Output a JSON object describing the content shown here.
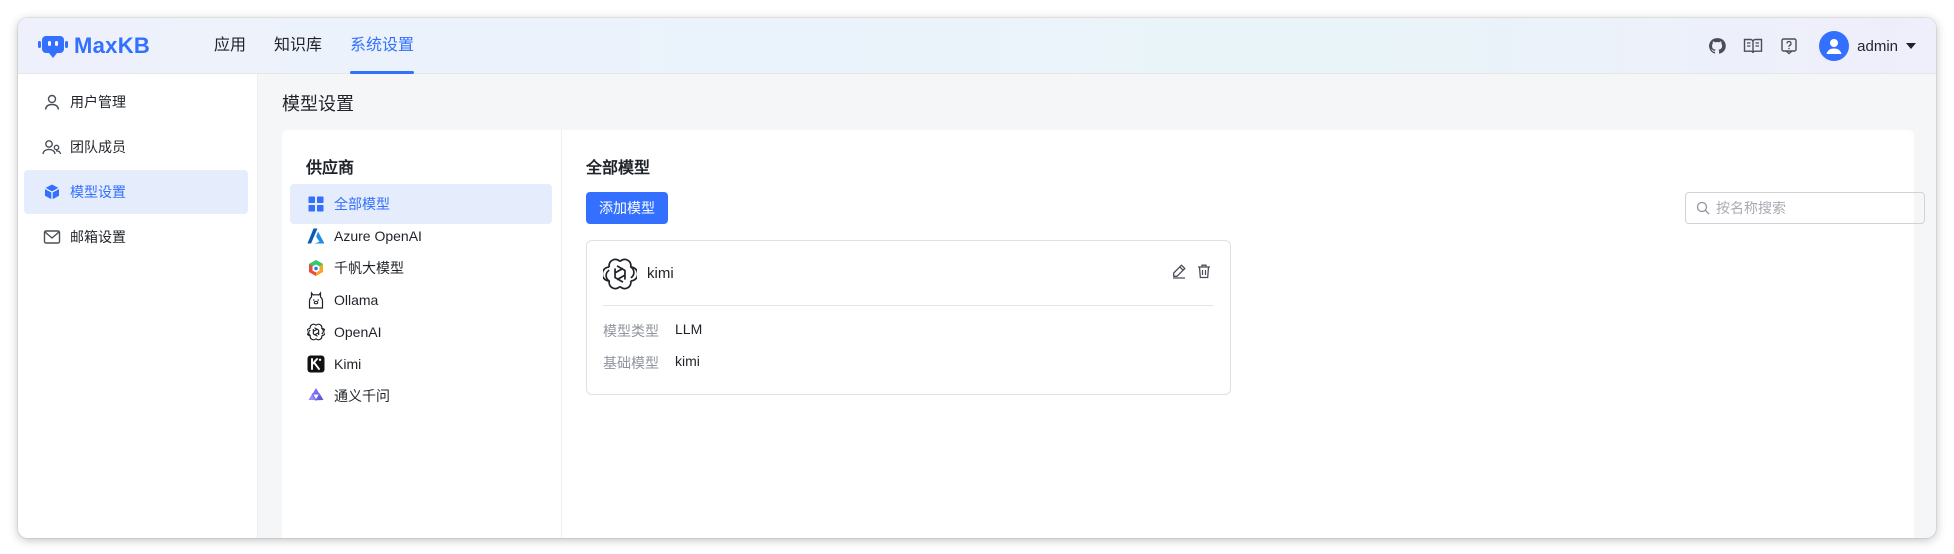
{
  "app": {
    "name": "MaxKB"
  },
  "topnav": {
    "items": [
      "应用",
      "知识库",
      "系统设置"
    ],
    "active_index": 2
  },
  "header": {
    "username": "admin",
    "icons": [
      "github-icon",
      "book-icon",
      "help-icon"
    ]
  },
  "sidebar": {
    "items": [
      {
        "label": "用户管理",
        "icon": "user-icon"
      },
      {
        "label": "团队成员",
        "icon": "team-icon"
      },
      {
        "label": "模型设置",
        "icon": "cube-icon"
      },
      {
        "label": "邮箱设置",
        "icon": "mail-icon"
      }
    ],
    "active_index": 2
  },
  "page": {
    "title": "模型设置"
  },
  "providers": {
    "title": "供应商",
    "items": [
      {
        "label": "全部模型",
        "icon": "grid-icon"
      },
      {
        "label": "Azure OpenAI",
        "icon": "azure-icon"
      },
      {
        "label": "千帆大模型",
        "icon": "qianfan-icon"
      },
      {
        "label": "Ollama",
        "icon": "ollama-icon"
      },
      {
        "label": "OpenAI",
        "icon": "openai-icon"
      },
      {
        "label": "Kimi",
        "icon": "kimi-icon"
      },
      {
        "label": "通义千问",
        "icon": "tongyi-icon"
      }
    ],
    "active_index": 0
  },
  "models": {
    "title": "全部模型",
    "add_label": "添加模型",
    "search_placeholder": "按名称搜索",
    "cards": [
      {
        "name": "kimi",
        "icon": "openai-icon",
        "type_label": "模型类型",
        "type_value": "LLM",
        "base_label": "基础模型",
        "base_value": "kimi"
      }
    ]
  },
  "colors": {
    "accent": "#3370ff",
    "active_bg": "#e5ecfb"
  }
}
